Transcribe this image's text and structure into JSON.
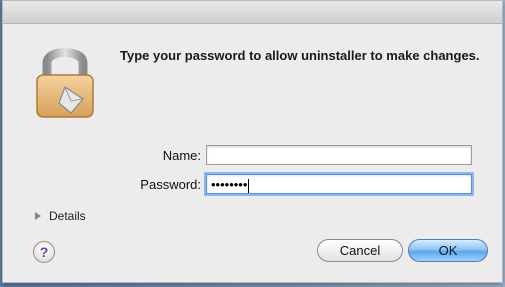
{
  "dialog": {
    "message": "Type your password to allow uninstaller to make changes.",
    "name_label": "Name:",
    "name_value": "",
    "password_label": "Password:",
    "password_value": "••••••••",
    "details_label": "Details",
    "help_label": "?",
    "cancel_label": "Cancel",
    "ok_label": "OK"
  },
  "colors": {
    "default_button": "#5ea6e9",
    "focus_ring": "#8cb6ef"
  }
}
